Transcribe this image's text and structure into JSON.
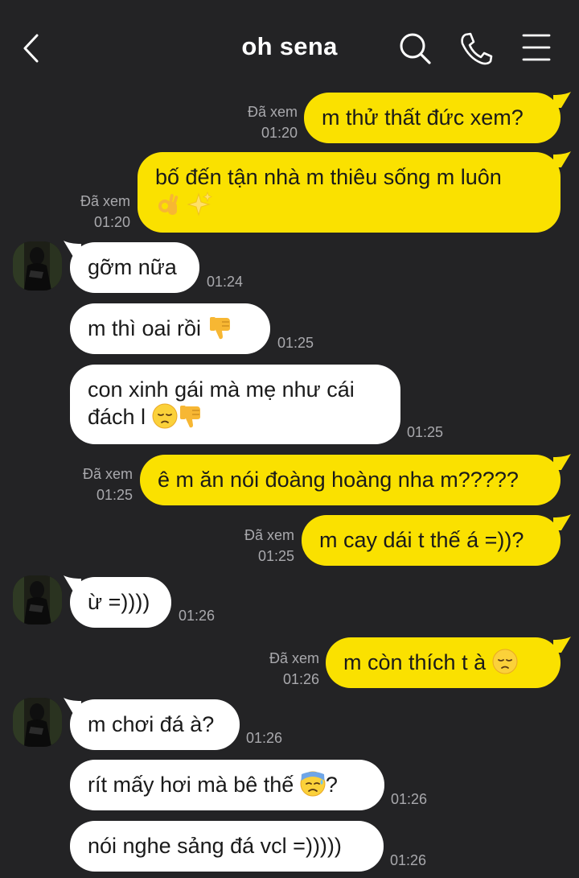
{
  "header": {
    "title": "oh sena",
    "back_icon": "chevron-left-icon",
    "search_icon": "search-icon",
    "call_icon": "phone-icon",
    "menu_icon": "hamburger-menu-icon"
  },
  "colors": {
    "background": "#232325",
    "outgoing_bubble": "#fae100",
    "incoming_bubble": "#ffffff",
    "meta_text": "#a9a9ad"
  },
  "messages": [
    {
      "direction": "out",
      "lines": [
        "m thử thất đức xem?"
      ],
      "read": "Đã xem",
      "time": "01:20"
    },
    {
      "direction": "out",
      "lines": [
        "bố đến tận nhà m thiêu sống m luôn"
      ],
      "emojis": [
        "ok-hand-emoji",
        "sparkles-emoji"
      ],
      "read": "Đã xem",
      "time": "01:20"
    },
    {
      "direction": "in",
      "lines": [
        "gỡm nữa"
      ],
      "time": "01:24",
      "avatar": true
    },
    {
      "direction": "in",
      "lines": [
        "m thì oai rồi"
      ],
      "emojis": [
        "thumbs-down-emoji"
      ],
      "time": "01:25"
    },
    {
      "direction": "in",
      "lines": [
        "con xinh gái mà mẹ như cái",
        "đách l"
      ],
      "emojis": [
        "pensive-face-emoji",
        "thumbs-down-emoji"
      ],
      "time": "01:25"
    },
    {
      "direction": "out",
      "lines": [
        "ê m ăn nói đoàng hoàng nha m?????"
      ],
      "read": "Đã xem",
      "time": "01:25"
    },
    {
      "direction": "out",
      "lines": [
        "m cay dái t thế á =))?"
      ],
      "read": "Đã xem",
      "time": "01:25"
    },
    {
      "direction": "in",
      "lines": [
        "ừ =))))"
      ],
      "time": "01:26",
      "avatar": true
    },
    {
      "direction": "out",
      "lines": [
        "m còn thích t à"
      ],
      "emojis": [
        "pensive-face-emoji"
      ],
      "read": "Đã xem",
      "time": "01:26"
    },
    {
      "direction": "in",
      "lines": [
        "m chơi đá à?"
      ],
      "time": "01:26",
      "avatar": true
    },
    {
      "direction": "in",
      "lines": [
        "rít mấy hơi mà bê thế"
      ],
      "suffix": "?",
      "emojis": [
        "anxious-face-with-sweat-emoji"
      ],
      "time": "01:26"
    },
    {
      "direction": "in",
      "lines": [
        "nói nghe sảng đá vcl =)))))"
      ],
      "time": "01:26"
    }
  ]
}
